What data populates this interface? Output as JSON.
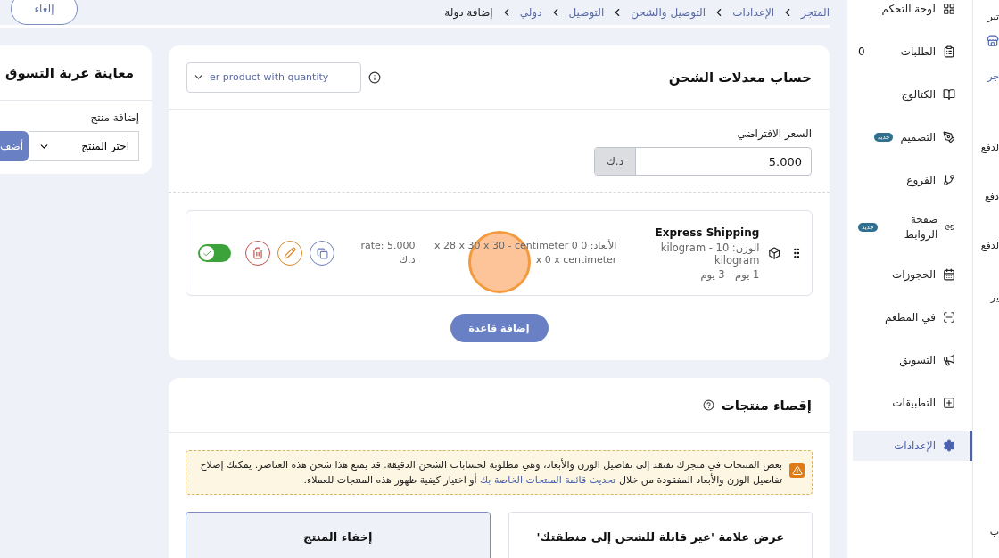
{
  "top_bar": {
    "cancel_button": "إلغاء",
    "breadcrumb": [
      {
        "label": "المتجر",
        "link": true
      },
      {
        "label": "الإعدادات",
        "link": true
      },
      {
        "label": "التوصيل والشحن",
        "link": true
      },
      {
        "label": "التوصيل",
        "link": true
      },
      {
        "label": "دولي",
        "link": true
      },
      {
        "label": "إضافة دولة",
        "link": false
      }
    ]
  },
  "cart_preview": {
    "title": "معاينة عربة التسوق",
    "field_label": "إضافة منتج",
    "select_value": "اختر المنتج",
    "add_button": "أضف"
  },
  "shipping_rates": {
    "title": "حساب معدلات الشحن",
    "method": "er product with quantity",
    "default_price_label": "السعر الافتراضي",
    "default_price": "5.000",
    "currency": "د.ك",
    "rules": [
      {
        "name": "Express Shipping",
        "weight": "الوزن: 10 - kilogram kilogram",
        "duration": "1 يوم - 3 يوم",
        "dimensions": "الأبعاد: 0 x 28 x 30 x 30 - centimeter 0 x 0 x centimeter",
        "rate": "rate: 5.000 د.ك",
        "enabled": true
      }
    ],
    "add_rule_button": "إضافة قاعدة"
  },
  "exclusions": {
    "title": "إقصاء منتجات",
    "alert": "بعض المنتجات في متجرك تفتقد إلى تفاصيل الوزن والأبعاد، وهي مطلوبة لحسابات الشحن الدقيقة. قد يمنع هذا شحن هذه العناصر. يمكنك إصلاح تفاصيل الوزن والأبعاد المفقودة من خلال",
    "alert_link": "تحديث قائمة المنتجات الخاصة بك",
    "alert_end": "أو اختيار كيفية ظهور هذه المنتجات للعملاء.",
    "options": [
      {
        "label": "عرض علامة 'غير قابلة للشحن إلى منطقتك'",
        "selected": false
      },
      {
        "label": "إخفاء المنتج",
        "selected": true
      }
    ]
  },
  "sidebar": {
    "items": [
      {
        "label": "لوحة التحكم",
        "selected": false
      },
      {
        "label": "الطلبات",
        "count": "0",
        "selected": false
      },
      {
        "label": "الكتالوج",
        "selected": false
      },
      {
        "label": "التصميم",
        "badge": "جديد",
        "selected": false
      },
      {
        "label": "الفروع",
        "selected": false
      },
      {
        "label": "صفحة الروابط",
        "badge": "جديد",
        "selected": false
      },
      {
        "label": "الحجوزات",
        "selected": false
      },
      {
        "label": "في المطعم",
        "selected": false
      },
      {
        "label": "التسويق",
        "selected": false
      },
      {
        "label": "التطبيقات",
        "selected": false
      },
      {
        "label": "الإعدادات",
        "selected": true
      }
    ]
  },
  "rail": {
    "labels": [
      "تير",
      "جر",
      "لدفع",
      "دفع",
      "لدفع",
      "ير",
      "ب"
    ]
  }
}
